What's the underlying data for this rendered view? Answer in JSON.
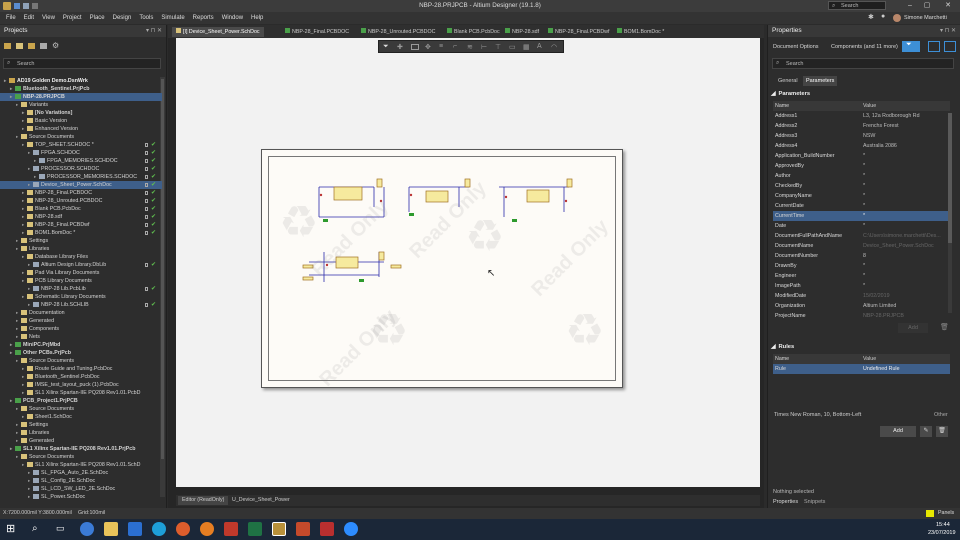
{
  "app": {
    "window_title": "NBP-28.PRJPCB - Altium Designer (19.1.8)",
    "search_placeholder": "Search",
    "user_name": "Simone Marchetti"
  },
  "menu": [
    "File",
    "Edit",
    "View",
    "Project",
    "Place",
    "Design",
    "Tools",
    "Simulate",
    "Reports",
    "Window",
    "Help"
  ],
  "projects_panel": {
    "title": "Projects",
    "search_placeholder": "Search",
    "tree": [
      {
        "label": "AD19 Golden Demo.DsnWrk",
        "indent": 0,
        "bold": true,
        "color": "#f0f0f0"
      },
      {
        "label": "Bluetooth_Sentinel.PrjPcb",
        "indent": 1,
        "bold": true
      },
      {
        "label": "NBP-28.PRJPCB",
        "indent": 1,
        "bold": true,
        "sel": true
      },
      {
        "label": "Variants",
        "indent": 2
      },
      {
        "label": "[No Variations]",
        "indent": 3,
        "bold": true
      },
      {
        "label": "Basic Version",
        "indent": 3
      },
      {
        "label": "Enhanced Version",
        "indent": 3
      },
      {
        "label": "Source Documents",
        "indent": 2
      },
      {
        "label": "TOP_SHEET.SCHDOC *",
        "indent": 3,
        "check": true
      },
      {
        "label": "FPGA.SCHDOC",
        "indent": 4,
        "check": true
      },
      {
        "label": "FPGA_MEMORIES.SCHDOC",
        "indent": 5,
        "check": true
      },
      {
        "label": "PROCESSOR.SCHDOC",
        "indent": 4,
        "check": true
      },
      {
        "label": "PROCESSOR_MEMORIES.SCHDOC",
        "indent": 5,
        "check": true
      },
      {
        "label": "Device_Sheet_Power.SchDoc",
        "indent": 4,
        "check": true,
        "sel": true
      },
      {
        "label": "NBP-28_Final.PCBDOC",
        "indent": 3,
        "check": true
      },
      {
        "label": "NBP-28_Unrouted.PCBDOC",
        "indent": 3,
        "check": true
      },
      {
        "label": "Blank PCB.PcbDoc",
        "indent": 3,
        "check": true
      },
      {
        "label": "NBP-28.sdf",
        "indent": 3,
        "check": true
      },
      {
        "label": "NBP-28_Final.PCBDwf",
        "indent": 3,
        "check": true
      },
      {
        "label": "BOM1.BomDoc *",
        "indent": 3,
        "check": true
      },
      {
        "label": "Settings",
        "indent": 2
      },
      {
        "label": "Libraries",
        "indent": 2
      },
      {
        "label": "Database Library Files",
        "indent": 3
      },
      {
        "label": "Altium Design Library.DbLib",
        "indent": 4,
        "check": true
      },
      {
        "label": "Pad Via Library Documents",
        "indent": 3
      },
      {
        "label": "PCB Library Documents",
        "indent": 3
      },
      {
        "label": "NBP-28 Lib.PcbLib",
        "indent": 4,
        "check": true
      },
      {
        "label": "Schematic Library Documents",
        "indent": 3
      },
      {
        "label": "NBP-28 Lib.SCHLIB",
        "indent": 4,
        "check": true
      },
      {
        "label": "Documentation",
        "indent": 2
      },
      {
        "label": "Generated",
        "indent": 2
      },
      {
        "label": "Components",
        "indent": 2
      },
      {
        "label": "Nets",
        "indent": 2
      },
      {
        "label": "MiniPC.PrjMbd",
        "indent": 1,
        "bold": true
      },
      {
        "label": "Other PCBs.PrjPcb",
        "indent": 1,
        "bold": true
      },
      {
        "label": "Source Documents",
        "indent": 2
      },
      {
        "label": "Route Guide and Tuning.PcbDoc",
        "indent": 3
      },
      {
        "label": "Bluetooth_Sentinel.PcbDoc",
        "indent": 3
      },
      {
        "label": "IMSE_test_layout_puck (1).PcbDoc",
        "indent": 3
      },
      {
        "label": "SL1 Xilinx Spartan-IIE PQ208 Rev1.01.PcbD",
        "indent": 3
      },
      {
        "label": "PCB_Project1.PrjPCB",
        "indent": 1,
        "bold": true
      },
      {
        "label": "Source Documents",
        "indent": 2
      },
      {
        "label": "Sheet1.SchDoc",
        "indent": 3
      },
      {
        "label": "Settings",
        "indent": 2
      },
      {
        "label": "Libraries",
        "indent": 2
      },
      {
        "label": "Generated",
        "indent": 2
      },
      {
        "label": "SL1 Xilinx Spartan-IIE PQ208 Rev1.01.PrjPcb",
        "indent": 1,
        "bold": true
      },
      {
        "label": "Source Documents",
        "indent": 2
      },
      {
        "label": "SL1 Xilinx Spartan-IIE PQ208 Rev1.01.SchD",
        "indent": 3
      },
      {
        "label": "SL_FPGA_Auto_2E.SchDoc",
        "indent": 4
      },
      {
        "label": "SL_Config_2E.SchDoc",
        "indent": 4
      },
      {
        "label": "SL_LCD_SW_LED_2E.SchDoc",
        "indent": 4
      },
      {
        "label": "SL_Power.SchDoc",
        "indent": 4
      }
    ]
  },
  "doc_tabs": [
    {
      "label": "[I] Device_Sheet_Power.SchDoc",
      "active": true
    },
    {
      "label": "NBP-28_Final.PCBDOC"
    },
    {
      "label": "NBP-28_Unrouted.PCBDOC"
    },
    {
      "label": "Blank PCB.PcbDoc"
    },
    {
      "label": "NBP-28.sdf"
    },
    {
      "label": "NBP-28_Final.PCBDwf"
    },
    {
      "label": "BOM1.BomDoc *"
    }
  ],
  "watermark": "Read Only",
  "bottom_tabs": [
    {
      "label": "Editor (ReadOnly)",
      "active": true
    },
    {
      "label": "U_Device_Sheet_Power"
    }
  ],
  "properties_panel": {
    "title": "Properties",
    "doc_options": "Document Options",
    "components_filter": "Components (and 11 more)",
    "search_placeholder": "Search",
    "tabs": [
      "General",
      "Parameters"
    ],
    "active_tab": "Parameters",
    "parameters_header": "Parameters",
    "col_name": "Name",
    "col_value": "Value",
    "params": [
      {
        "name": "Address1",
        "value": "L3, 12a Rodborough Rd"
      },
      {
        "name": "Address2",
        "value": "Frenchs Forest"
      },
      {
        "name": "Address3",
        "value": "NSW"
      },
      {
        "name": "Address4",
        "value": "Australia 2086"
      },
      {
        "name": "Application_BuildNumber",
        "value": "*"
      },
      {
        "name": "ApprovedBy",
        "value": "*"
      },
      {
        "name": "Author",
        "value": "*"
      },
      {
        "name": "CheckedBy",
        "value": "*"
      },
      {
        "name": "CompanyName",
        "value": "*"
      },
      {
        "name": "CurrentDate",
        "value": "*"
      },
      {
        "name": "CurrentTime",
        "value": "*",
        "sel": true
      },
      {
        "name": "Date",
        "value": "*"
      },
      {
        "name": "DocumentFullPathAndName",
        "value": "C:\\Users\\simone.marchetti\\Des...",
        "dim": true
      },
      {
        "name": "DocumentName",
        "value": "Device_Sheet_Power.SchDoc",
        "dim": true
      },
      {
        "name": "DocumentNumber",
        "value": "8"
      },
      {
        "name": "DrawnBy",
        "value": "*"
      },
      {
        "name": "Engineer",
        "value": "*"
      },
      {
        "name": "ImagePath",
        "value": "*"
      },
      {
        "name": "ModifiedDate",
        "value": "15/02/2019",
        "dim": true
      },
      {
        "name": "Organization",
        "value": "Altium Limited"
      },
      {
        "name": "ProjectName",
        "value": "NBP-28.PRJPCB",
        "dim": true
      }
    ],
    "add_label": "Add",
    "rules_header": "Rules",
    "rules": [
      {
        "name": "Rule",
        "value": "Undefined Rule",
        "sel": true
      }
    ],
    "font_text": "Times New Roman, 10, Bottom-Left",
    "other_label": "Other",
    "nothing_selected": "Nothing selected",
    "bottom_tabs": [
      "Properties",
      "Snippets"
    ]
  },
  "status": {
    "coords": "X:7200.000mil Y:3800.000mil",
    "grid": "Grid:100mil",
    "panels_label": "Panels"
  },
  "taskbar": {
    "time": "15:44",
    "date": "23/07/2019"
  },
  "colors": {
    "selection": "#3e5f8a",
    "accent": "#3d8fd6",
    "check": "#5fbf4f"
  }
}
